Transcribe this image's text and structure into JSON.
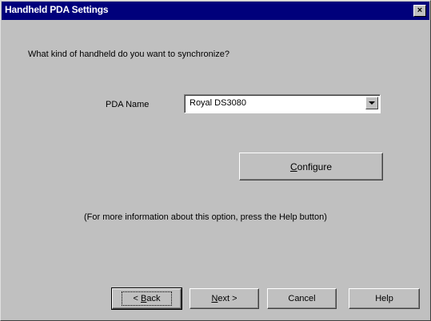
{
  "window": {
    "title": "Handheld PDA Settings",
    "close_glyph": "×"
  },
  "question": "What kind of handheld do you want to synchronize?",
  "pda": {
    "label": "PDA Name",
    "selected": "Royal DS3080"
  },
  "configure_button": {
    "mnemonic": "C",
    "rest": "onfigure"
  },
  "info_text": "(For more information about this option, press the Help button)",
  "buttons": {
    "back": {
      "prefix": "< ",
      "mnemonic": "B",
      "rest": "ack"
    },
    "next": {
      "mnemonic": "N",
      "rest": "ext >"
    },
    "cancel": "Cancel",
    "help": "Help"
  },
  "colors": {
    "titlebar": "#00007b",
    "face": "#c0c0c0"
  }
}
